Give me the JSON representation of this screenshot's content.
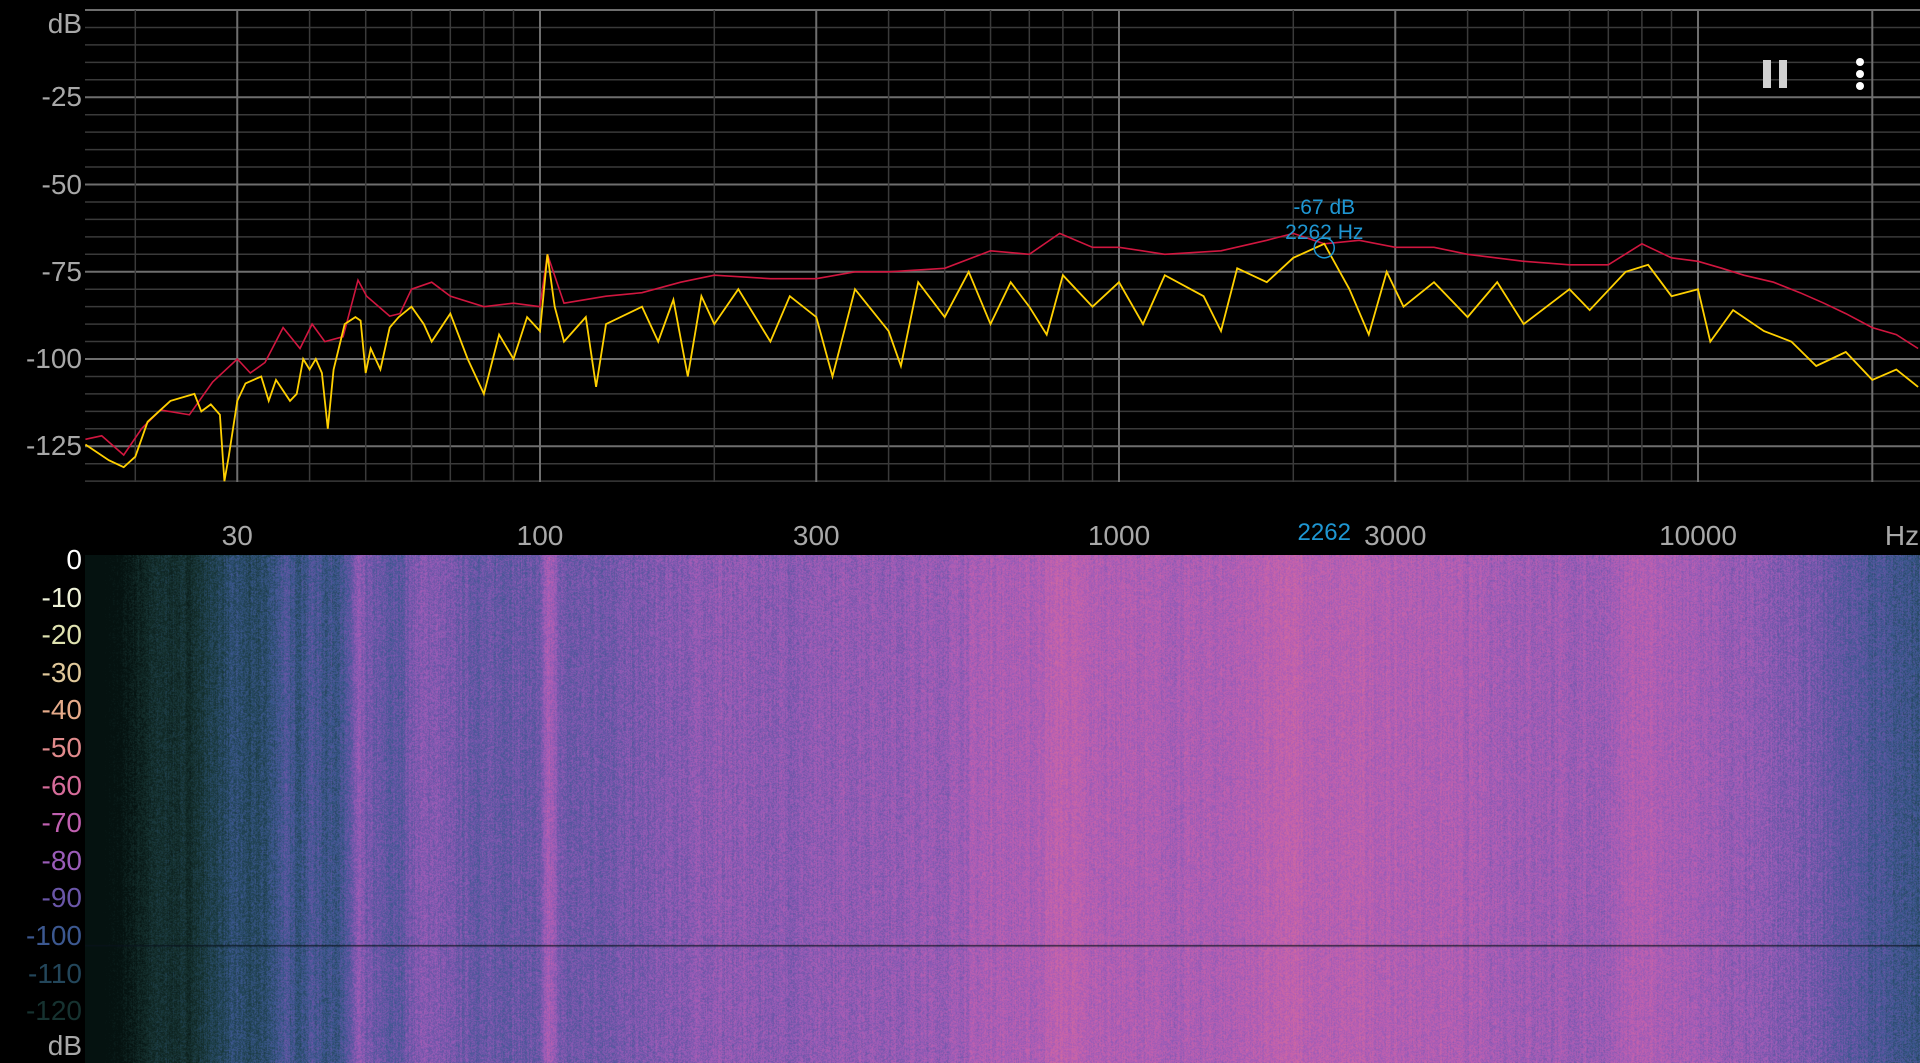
{
  "chart_data": [
    {
      "type": "line",
      "title": "",
      "x_scale": "log",
      "xlim": [
        16.4,
        24000
      ],
      "ylim": [
        -135,
        0
      ],
      "grid": true,
      "xlabel_unit": "Hz",
      "ylabel_unit": "dB",
      "x_ticks": [
        {
          "value": 30,
          "label": "30"
        },
        {
          "value": 100,
          "label": "100"
        },
        {
          "value": 300,
          "label": "300"
        },
        {
          "value": 1000,
          "label": "1000"
        },
        {
          "value": 3000,
          "label": "3000"
        },
        {
          "value": 10000,
          "label": "10000"
        }
      ],
      "x_gridlines_major": [
        30,
        100,
        300,
        1000,
        3000,
        10000,
        20000
      ],
      "x_gridlines_minor": [
        20,
        40,
        50,
        60,
        70,
        80,
        90,
        200,
        400,
        500,
        600,
        700,
        800,
        900,
        2000,
        4000,
        5000,
        6000,
        7000,
        8000,
        9000
      ],
      "y_ticks": [
        {
          "value": -25,
          "label": "-25"
        },
        {
          "value": -50,
          "label": "-50"
        },
        {
          "value": -75,
          "label": "-75"
        },
        {
          "value": -100,
          "label": "-100"
        },
        {
          "value": -125,
          "label": "-125"
        }
      ],
      "y_minor_step": 5,
      "series": [
        {
          "color": "#d0163f",
          "points": [
            [
              16.4,
              -123
            ],
            [
              17.5,
              -122
            ],
            [
              19.1,
              -127.5
            ],
            [
              20.5,
              -120
            ],
            [
              22.1,
              -114.6
            ],
            [
              24.8,
              -116
            ],
            [
              27.2,
              -106.6
            ],
            [
              30,
              -100
            ],
            [
              31.6,
              -104
            ],
            [
              33.5,
              -101
            ],
            [
              36,
              -91
            ],
            [
              38.5,
              -97
            ],
            [
              40.4,
              -90
            ],
            [
              42.5,
              -95
            ],
            [
              45.7,
              -93.6
            ],
            [
              48.5,
              -77.4
            ],
            [
              50.2,
              -82
            ],
            [
              55,
              -87.7
            ],
            [
              57.3,
              -87
            ],
            [
              60,
              -80
            ],
            [
              65,
              -78
            ],
            [
              70,
              -82
            ],
            [
              80,
              -85
            ],
            [
              90,
              -84
            ],
            [
              100,
              -85
            ],
            [
              103,
              -70
            ],
            [
              110,
              -84
            ],
            [
              130,
              -82
            ],
            [
              150,
              -81
            ],
            [
              175,
              -78
            ],
            [
              200,
              -76
            ],
            [
              250,
              -77
            ],
            [
              300,
              -77
            ],
            [
              350,
              -75
            ],
            [
              400,
              -75
            ],
            [
              500,
              -74
            ],
            [
              600,
              -69
            ],
            [
              700,
              -70
            ],
            [
              790,
              -64
            ],
            [
              900,
              -68
            ],
            [
              1000,
              -68
            ],
            [
              1200,
              -70
            ],
            [
              1500,
              -69
            ],
            [
              1800,
              -66
            ],
            [
              2000,
              -64
            ],
            [
              2262,
              -67
            ],
            [
              2600,
              -66
            ],
            [
              3000,
              -68
            ],
            [
              3500,
              -68
            ],
            [
              4000,
              -70
            ],
            [
              5000,
              -72
            ],
            [
              6000,
              -73
            ],
            [
              7000,
              -73
            ],
            [
              8000,
              -67
            ],
            [
              9000,
              -71
            ],
            [
              10000,
              -72
            ],
            [
              11000,
              -74
            ],
            [
              12000,
              -76
            ],
            [
              13500,
              -78
            ],
            [
              15000,
              -81
            ],
            [
              16500,
              -84
            ],
            [
              18000,
              -87
            ],
            [
              20000,
              -91
            ],
            [
              22000,
              -93
            ],
            [
              24000,
              -97
            ]
          ]
        },
        {
          "color": "#ffd000",
          "points": [
            [
              16.4,
              -124.5
            ],
            [
              18,
              -129
            ],
            [
              19.1,
              -131
            ],
            [
              20,
              -128
            ],
            [
              21,
              -118
            ],
            [
              23,
              -112
            ],
            [
              25.3,
              -110
            ],
            [
              26,
              -115
            ],
            [
              27,
              -113
            ],
            [
              28,
              -116
            ],
            [
              28.5,
              -135
            ],
            [
              29,
              -128
            ],
            [
              30,
              -112
            ],
            [
              31,
              -107
            ],
            [
              33,
              -105
            ],
            [
              34,
              -112
            ],
            [
              35,
              -106
            ],
            [
              37,
              -112
            ],
            [
              38,
              -110
            ],
            [
              39,
              -100
            ],
            [
              40,
              -103
            ],
            [
              41,
              -100
            ],
            [
              42,
              -104
            ],
            [
              43,
              -120
            ],
            [
              44,
              -103
            ],
            [
              46,
              -90
            ],
            [
              48,
              -88
            ],
            [
              49,
              -89
            ],
            [
              50,
              -104
            ],
            [
              51,
              -97
            ],
            [
              53,
              -103
            ],
            [
              55,
              -91
            ],
            [
              57,
              -88
            ],
            [
              60,
              -85
            ],
            [
              63,
              -90
            ],
            [
              65,
              -95
            ],
            [
              70,
              -87
            ],
            [
              75,
              -100
            ],
            [
              80,
              -110
            ],
            [
              85,
              -93
            ],
            [
              90,
              -100
            ],
            [
              95,
              -88
            ],
            [
              100,
              -92
            ],
            [
              103,
              -70
            ],
            [
              106,
              -85
            ],
            [
              110,
              -95
            ],
            [
              120,
              -88
            ],
            [
              125,
              -108
            ],
            [
              130,
              -90
            ],
            [
              150,
              -85
            ],
            [
              160,
              -95
            ],
            [
              170,
              -83
            ],
            [
              180,
              -105
            ],
            [
              190,
              -82
            ],
            [
              200,
              -90
            ],
            [
              220,
              -80
            ],
            [
              250,
              -95
            ],
            [
              270,
              -82
            ],
            [
              300,
              -88
            ],
            [
              320,
              -105
            ],
            [
              350,
              -80
            ],
            [
              400,
              -92
            ],
            [
              420,
              -102
            ],
            [
              450,
              -78
            ],
            [
              500,
              -88
            ],
            [
              550,
              -75
            ],
            [
              600,
              -90
            ],
            [
              650,
              -78
            ],
            [
              700,
              -85
            ],
            [
              750,
              -93
            ],
            [
              800,
              -76
            ],
            [
              900,
              -85
            ],
            [
              1000,
              -78
            ],
            [
              1100,
              -90
            ],
            [
              1200,
              -76
            ],
            [
              1400,
              -82
            ],
            [
              1500,
              -92
            ],
            [
              1600,
              -74
            ],
            [
              1800,
              -78
            ],
            [
              2000,
              -71
            ],
            [
              2262,
              -67
            ],
            [
              2500,
              -80
            ],
            [
              2700,
              -93
            ],
            [
              2900,
              -75
            ],
            [
              3100,
              -85
            ],
            [
              3500,
              -78
            ],
            [
              4000,
              -88
            ],
            [
              4500,
              -78
            ],
            [
              5000,
              -90
            ],
            [
              6000,
              -80
            ],
            [
              6500,
              -86
            ],
            [
              7500,
              -75
            ],
            [
              8200,
              -73
            ],
            [
              9000,
              -82
            ],
            [
              10000,
              -80
            ],
            [
              10500,
              -95
            ],
            [
              11500,
              -86
            ],
            [
              13000,
              -92
            ],
            [
              14500,
              -95
            ],
            [
              16000,
              -102
            ],
            [
              18000,
              -98
            ],
            [
              20000,
              -106
            ],
            [
              22000,
              -103
            ],
            [
              24000,
              -108
            ]
          ]
        }
      ],
      "cursor": {
        "freq": 2262,
        "db": -67,
        "db_label": "-67 dB",
        "hz_label": "2262 Hz",
        "axis_label": "2262",
        "color": "#1e96d2"
      }
    },
    {
      "type": "heatmap",
      "title": "",
      "ylabel_unit": "dB",
      "scale_labels": [
        {
          "value": 0,
          "label": "0",
          "color": "#ffffff"
        },
        {
          "value": -10,
          "label": "-10",
          "color": "#eef2d8"
        },
        {
          "value": -20,
          "label": "-20",
          "color": "#dfe2b0"
        },
        {
          "value": -30,
          "label": "-30",
          "color": "#e0c89a"
        },
        {
          "value": -40,
          "label": "-40",
          "color": "#e6ab8a"
        },
        {
          "value": -50,
          "label": "-50",
          "color": "#e08a8c"
        },
        {
          "value": -60,
          "label": "-60",
          "color": "#d66c9a"
        },
        {
          "value": -70,
          "label": "-70",
          "color": "#c060b0"
        },
        {
          "value": -80,
          "label": "-80",
          "color": "#9a5cb8"
        },
        {
          "value": -90,
          "label": "-90",
          "color": "#6a56a8"
        },
        {
          "value": -100,
          "label": "-100",
          "color": "#3c5890"
        },
        {
          "value": -110,
          "label": "-110",
          "color": "#23465a"
        },
        {
          "value": -120,
          "label": "-120",
          "color": "#163230"
        }
      ]
    }
  ],
  "axes": {
    "top_unit": "dB",
    "x_unit": "Hz",
    "bottom_unit": "dB"
  },
  "controls": {
    "pause_icon": "pause-icon",
    "menu_icon": "more-vert-icon"
  }
}
